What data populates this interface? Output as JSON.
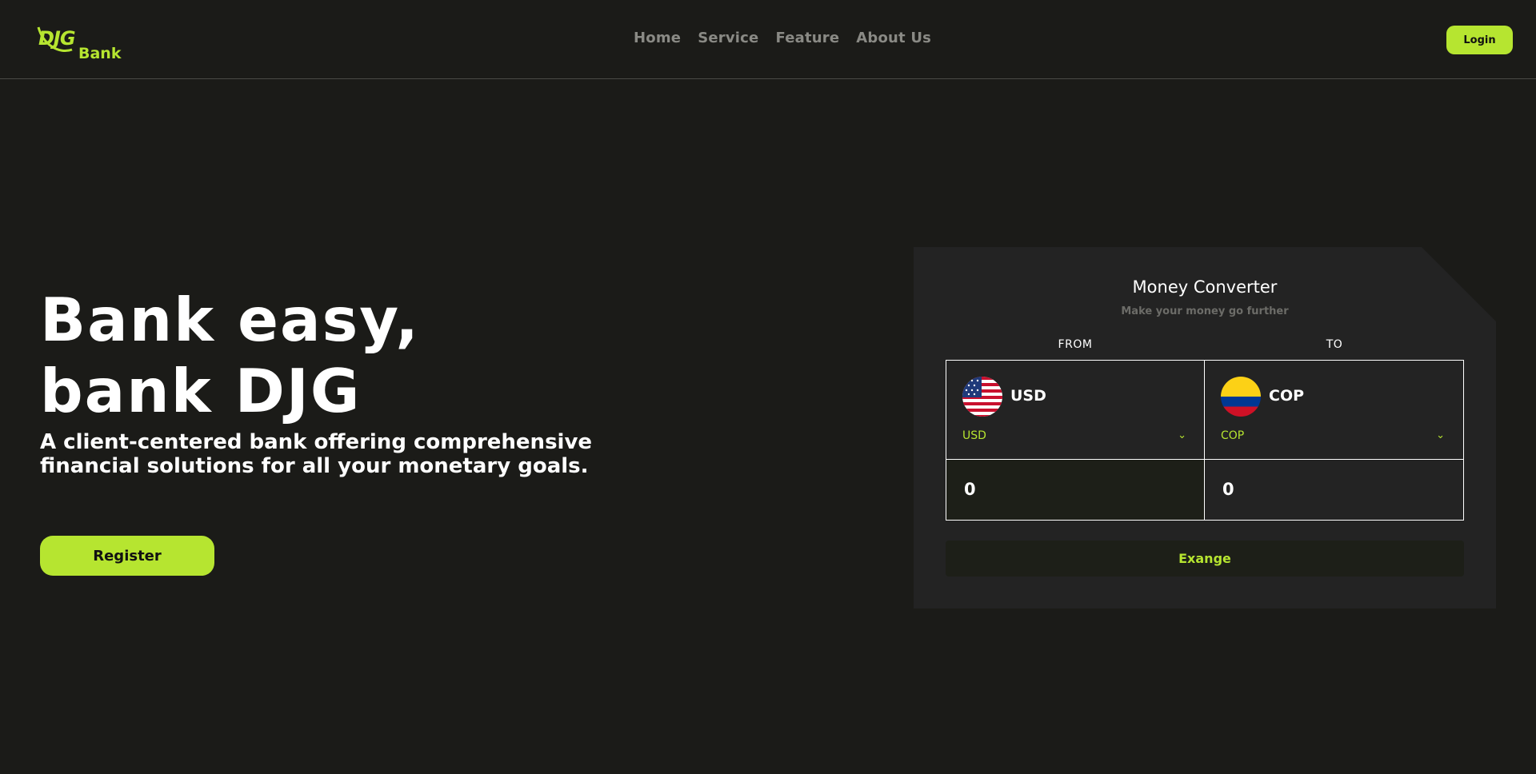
{
  "brand": {
    "logo_mark": "DJG",
    "logo_text": "Bank"
  },
  "nav": {
    "items": [
      "Home",
      "Service",
      "Feature",
      "About Us"
    ]
  },
  "header": {
    "login_label": "Login"
  },
  "hero": {
    "title_line1": "Bank easy,",
    "title_line2": "bank DJG",
    "subtitle": "A client-centered bank offering comprehensive financial solutions for all your monetary goals.",
    "register_label": "Register"
  },
  "converter": {
    "title": "Money Converter",
    "subtitle": "Make your money go further",
    "from_label": "FROM",
    "to_label": "TO",
    "from": {
      "code": "USD",
      "selected": "USD",
      "amount": "0",
      "flag_icon": "us-flag-icon"
    },
    "to": {
      "code": "COP",
      "selected": "COP",
      "amount": "0",
      "flag_icon": "colombia-flag-icon"
    },
    "exchange_label": "Exange"
  },
  "colors": {
    "accent": "#b6e530",
    "background": "#1b1b18",
    "card": "#232323"
  }
}
